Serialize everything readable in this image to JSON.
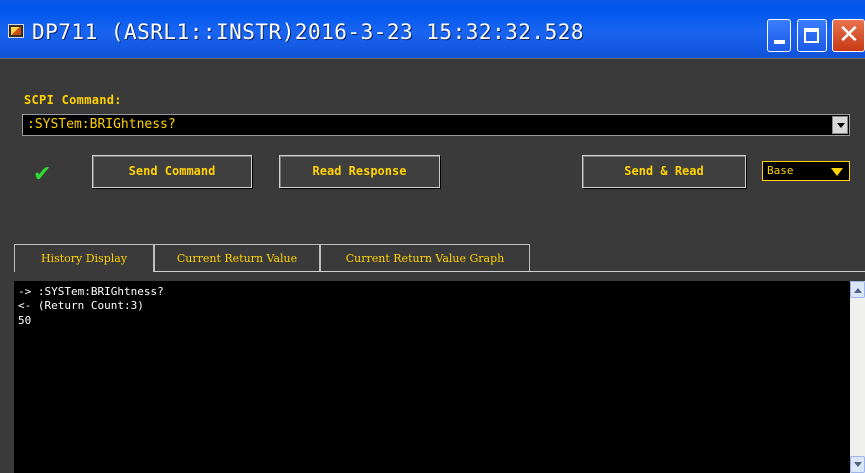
{
  "window": {
    "title": "DP711 (ASRL1::INSTR)2016-3-23 15:32:32.528",
    "icon": "instrument-app-icon"
  },
  "scpi": {
    "label": "SCPI Command:",
    "command": ":SYSTem:BRIGhtness?"
  },
  "buttons": {
    "send_command": "Send Command",
    "read_response": "Read Response",
    "send_read": "Send & Read"
  },
  "base_select": {
    "value": "Base"
  },
  "status_icon": "checkmark-icon",
  "tabs": [
    {
      "label": "History Display"
    },
    {
      "label": "Current Return Value"
    },
    {
      "label": "Current Return Value Graph"
    }
  ],
  "history": {
    "lines": [
      "-> :SYSTem:BRIGhtness?",
      "<- (Return Count:3)",
      "50"
    ]
  },
  "colors": {
    "accent": "#ffd200",
    "title_bar": "#0058ee",
    "background": "#3a3a3a",
    "success": "#2fd92f"
  }
}
